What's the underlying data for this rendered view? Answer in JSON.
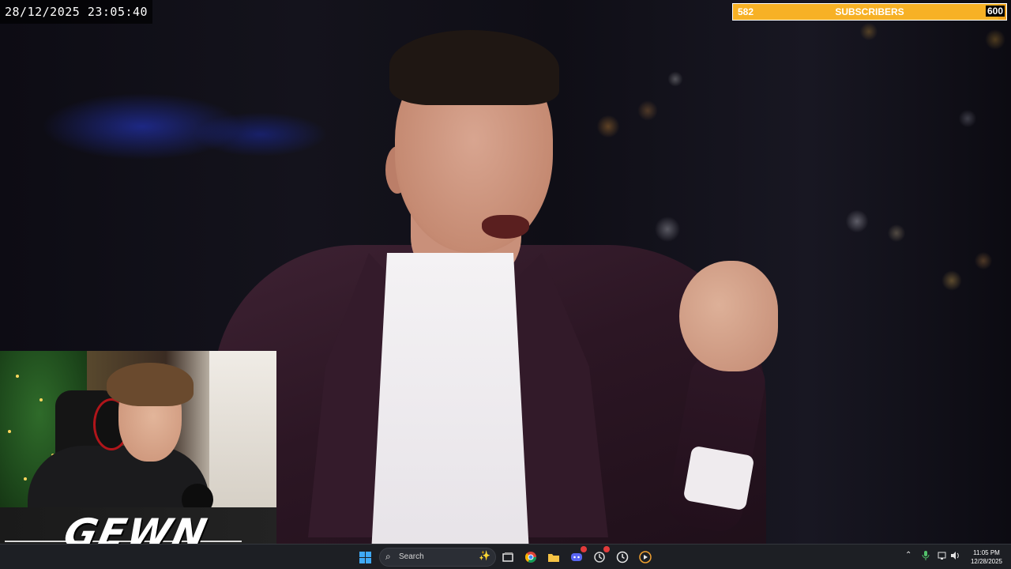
{
  "overlay": {
    "datetime": "28/12/2025 23:05:40"
  },
  "subscriber_goal": {
    "current": "582",
    "label": "SUBSCRIBERS",
    "goal": "600",
    "progress_fraction": 0.97,
    "bar_color": "#f2a51f"
  },
  "webcam": {
    "brand_logo": "GEWN"
  },
  "taskbar": {
    "search_placeholder": "Search",
    "apps": [
      {
        "name": "start",
        "icon": "windows-icon"
      },
      {
        "name": "search",
        "icon": "search-icon"
      },
      {
        "name": "task-view",
        "icon": "task-view-icon"
      },
      {
        "name": "chrome",
        "icon": "chrome-icon"
      },
      {
        "name": "file-explorer",
        "icon": "folder-icon"
      },
      {
        "name": "discord",
        "icon": "discord-icon"
      },
      {
        "name": "app-red-badge",
        "icon": "app-icon"
      },
      {
        "name": "clock",
        "icon": "clock-icon"
      },
      {
        "name": "media-player",
        "icon": "play-icon"
      }
    ],
    "tray": {
      "time": "11:05 PM",
      "date": "12/28/2025"
    },
    "accent_color": "#3fa9f5"
  }
}
